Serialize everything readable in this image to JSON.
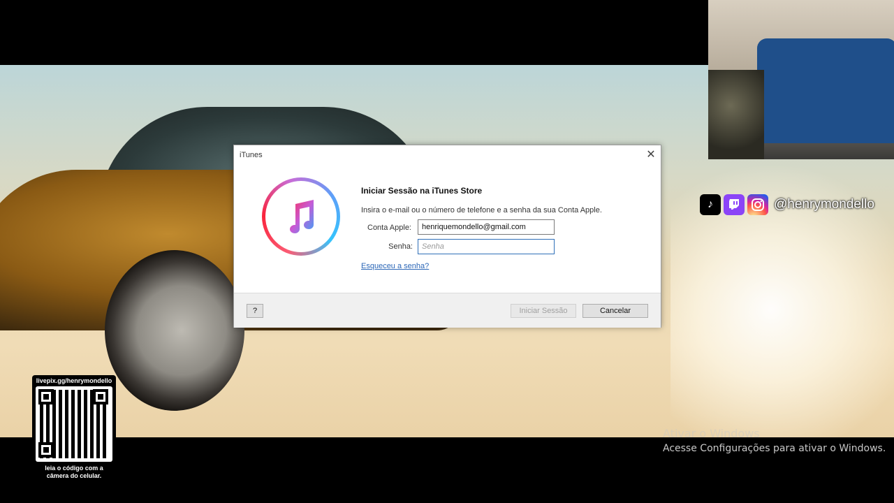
{
  "dialog": {
    "title": "iTunes",
    "heading": "Iniciar Sessão na iTunes Store",
    "instructions": "Insira o e-mail ou o número de telefone e a senha da sua Conta Apple.",
    "apple_id_label": "Conta Apple:",
    "apple_id_value": "henriquemondello@gmail.com",
    "password_label": "Senha:",
    "password_placeholder": "Senha",
    "forgot_link": "Esqueceu a senha?",
    "help_button": "?",
    "sign_in_button": "Iniciar Sessão",
    "cancel_button": "Cancelar",
    "close_glyph": "✕"
  },
  "overlay": {
    "social_handle": "@henrymondello",
    "social_icons": [
      "tiktok-icon",
      "twitch-icon",
      "instagram-icon"
    ],
    "qr_url": "livepix.gg/henrymondello",
    "qr_caption_line1": "leia o código com a",
    "qr_caption_line2": "câmera do celular."
  },
  "windows_activation": {
    "title": "Ativar o Windows",
    "subtitle": "Acesse Configurações para ativar o Windows."
  },
  "colors": {
    "link": "#2c67b7",
    "twitch": "#8b44f7"
  }
}
